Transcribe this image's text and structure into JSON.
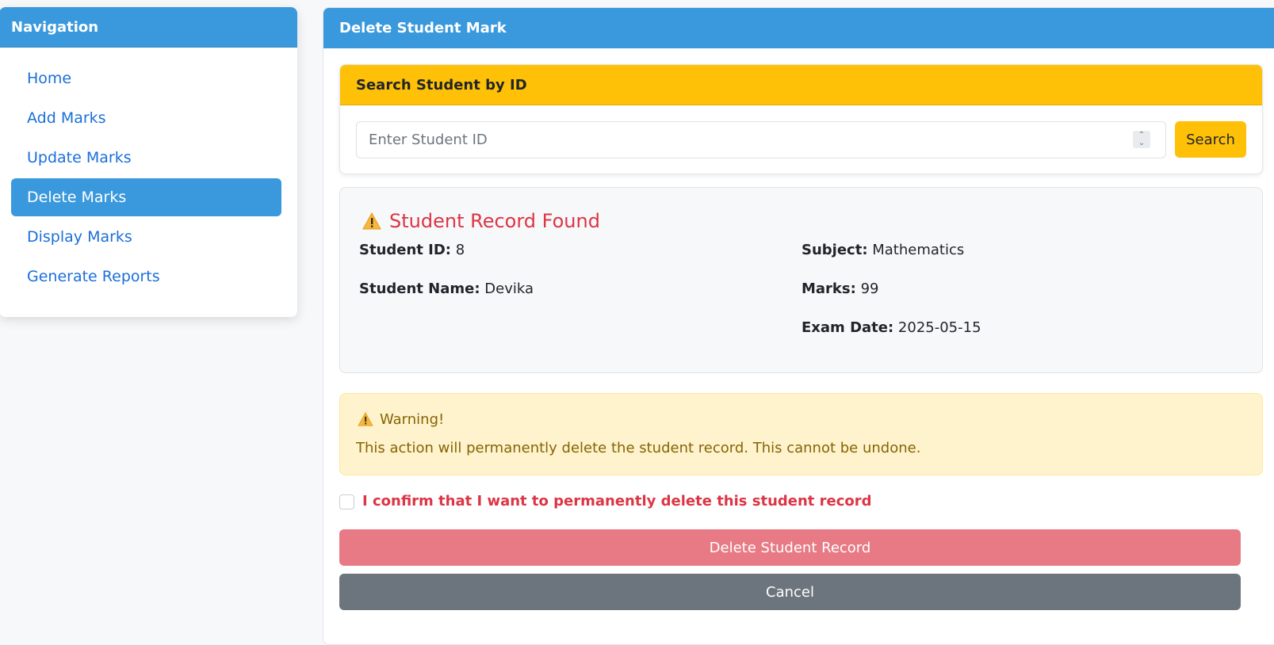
{
  "navigation": {
    "title": "Navigation",
    "items": [
      {
        "label": "Home"
      },
      {
        "label": "Add Marks"
      },
      {
        "label": "Update Marks"
      },
      {
        "label": "Delete Marks"
      },
      {
        "label": "Display Marks"
      },
      {
        "label": "Generate Reports"
      }
    ],
    "active_item": "Delete Marks"
  },
  "page": {
    "title": "Delete Student Mark"
  },
  "search": {
    "title": "Search Student by ID",
    "placeholder": "Enter Student ID",
    "value": "",
    "button_label": "Search"
  },
  "record": {
    "heading": "Student Record Found",
    "student_id_label": "Student ID:",
    "student_id": "8",
    "student_name_label": "Student Name:",
    "student_name": "Devika",
    "subject_label": "Subject:",
    "subject": "Mathematics",
    "marks_label": "Marks:",
    "marks": "99",
    "exam_date_label": "Exam Date:",
    "exam_date": "2025-05-15"
  },
  "warning": {
    "title": "Warning!",
    "message": "This action will permanently delete the student record. This cannot be undone."
  },
  "confirm": {
    "label": "I confirm that I want to permanently delete this student record",
    "checked": false
  },
  "actions": {
    "delete_label": "Delete Student Record",
    "cancel_label": "Cancel"
  },
  "colors": {
    "primary": "#3a99dc",
    "warning": "#ffc107",
    "danger": "#dc3545",
    "secondary": "#6c757d"
  },
  "icons": {
    "record_icon": "warning-triangle-icon",
    "alert_icon": "warning-triangle-icon"
  }
}
